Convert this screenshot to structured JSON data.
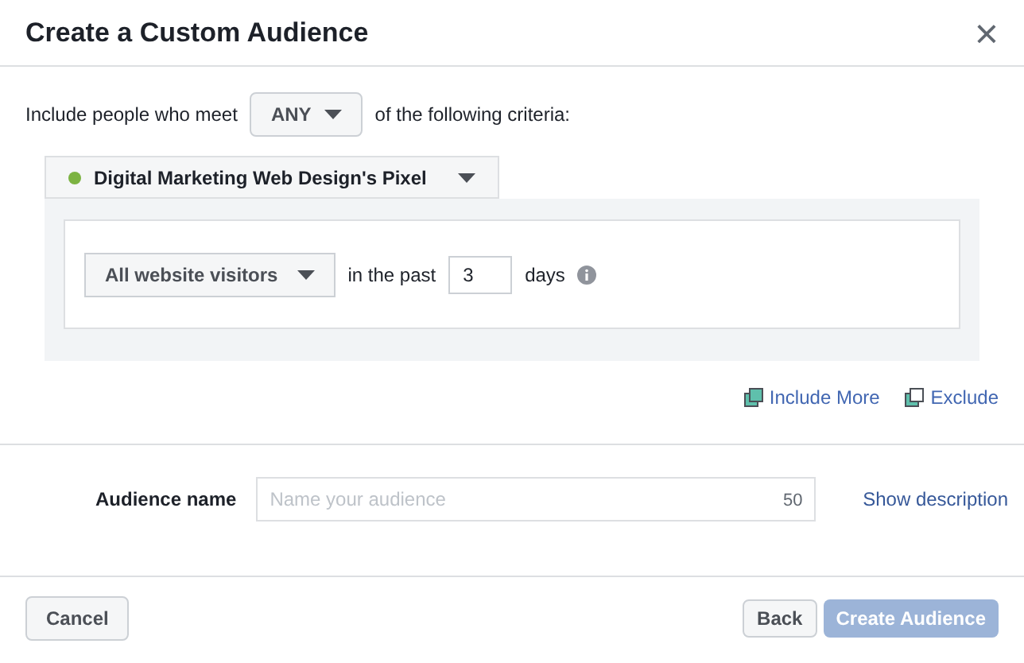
{
  "dialog": {
    "title": "Create a Custom Audience",
    "close": "×"
  },
  "criteria": {
    "prefix": "Include people who meet",
    "match": "ANY",
    "suffix": "of the following criteria:"
  },
  "pixel": {
    "name": "Digital Marketing Web Design's Pixel",
    "color": "#7cb342"
  },
  "rule": {
    "audience": "All website visitors",
    "in_past": "in the past",
    "days_value": "3",
    "days": "days"
  },
  "links": [
    {
      "label": "Include More",
      "kind": "include"
    },
    {
      "label": "Exclude",
      "kind": "exclude"
    }
  ],
  "audience_name": {
    "label": "Audience name",
    "placeholder": "Name your audience",
    "counter": "50",
    "link": "Show description"
  },
  "footer": {
    "cancel": "Cancel",
    "back": "Back",
    "create": {
      "label": "Create Audience",
      "disabled": true
    }
  }
}
